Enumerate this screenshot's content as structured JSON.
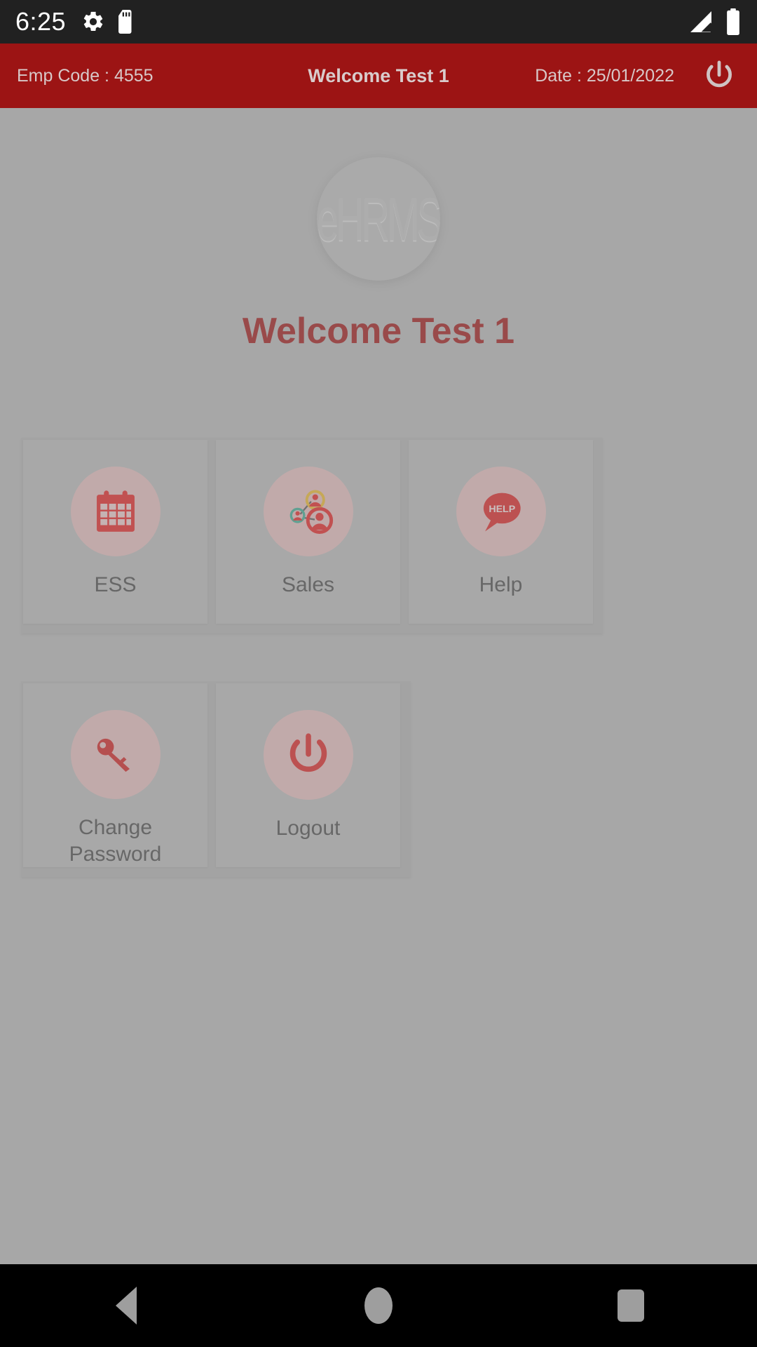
{
  "status_bar": {
    "time": "6:25",
    "icons_left": [
      "settings-gear-icon",
      "sd-card-icon"
    ],
    "icons_right": [
      "signal-icon",
      "battery-icon"
    ]
  },
  "app_bar": {
    "emp_code": "Emp Code : 4555",
    "title": "Welcome Test 1",
    "date": "Date : 25/01/2022",
    "power_icon": "power-icon",
    "background_color": "#9c1414",
    "text_color": "#d8c8c8"
  },
  "main": {
    "logo_text": "eHRMS",
    "welcome_heading": "Welcome Test 1",
    "welcome_color": "#9c1414",
    "background_color": "#b3b3b3",
    "rows": [
      {
        "tiles": [
          {
            "label": "ESS",
            "icon": "calendar-icon",
            "icon_color": "#e02020"
          },
          {
            "label": "Sales",
            "icon": "people-network-icon",
            "icon_color": "#e02020"
          },
          {
            "label": "Help",
            "icon": "help-speech-bubble-icon",
            "icon_color": "#d81f1f",
            "icon_text": "HELP"
          }
        ]
      },
      {
        "tiles": [
          {
            "label": "Change Password",
            "icon": "key-icon",
            "icon_color": "#cc1c1c"
          },
          {
            "label": "Logout",
            "icon": "power-icon",
            "icon_color": "#d81f1f"
          }
        ]
      }
    ]
  },
  "nav_bar": {
    "back": "back-triangle-icon",
    "home": "home-circle-icon",
    "recents": "recents-square-icon"
  }
}
